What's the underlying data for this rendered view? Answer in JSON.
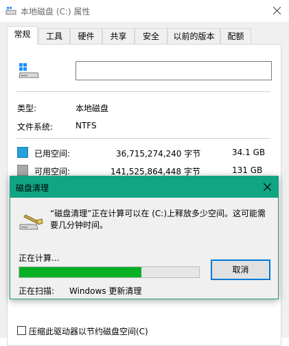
{
  "window": {
    "title": "本地磁盘 (C:) 属性"
  },
  "tabs": [
    {
      "label": "常规",
      "active": true
    },
    {
      "label": "工具"
    },
    {
      "label": "硬件"
    },
    {
      "label": "共享"
    },
    {
      "label": "安全"
    },
    {
      "label": "以前的版本"
    },
    {
      "label": "配额"
    }
  ],
  "general": {
    "drive_name_value": "",
    "type_label": "类型:",
    "type_value": "本地磁盘",
    "fs_label": "文件系统:",
    "fs_value": "NTFS",
    "used": {
      "label": "已用空间:",
      "bytes": "36,715,274,240 字节",
      "size": "34.1 GB",
      "color": "#26a0da"
    },
    "free": {
      "label": "可用空间:",
      "bytes": "141,525,864,448 字节",
      "size": "131 GB",
      "color": "#a8a8a8"
    },
    "compress_label": "压缩此驱动器以节约磁盘空间(C)",
    "compress_checked": false
  },
  "dialog": {
    "title": "磁盘清理",
    "message": "“磁盘清理”正在计算可以在 (C:)上释放多少空间。这可能需要几分钟时间。",
    "calculating_label": "正在计算...",
    "progress_fraction": 0.68,
    "cancel_label": "取消",
    "scanning_label": "正在扫描:",
    "scanning_value": "Windows 更新清理",
    "accent_color": "#11a683",
    "progress_color": "#06b025"
  }
}
